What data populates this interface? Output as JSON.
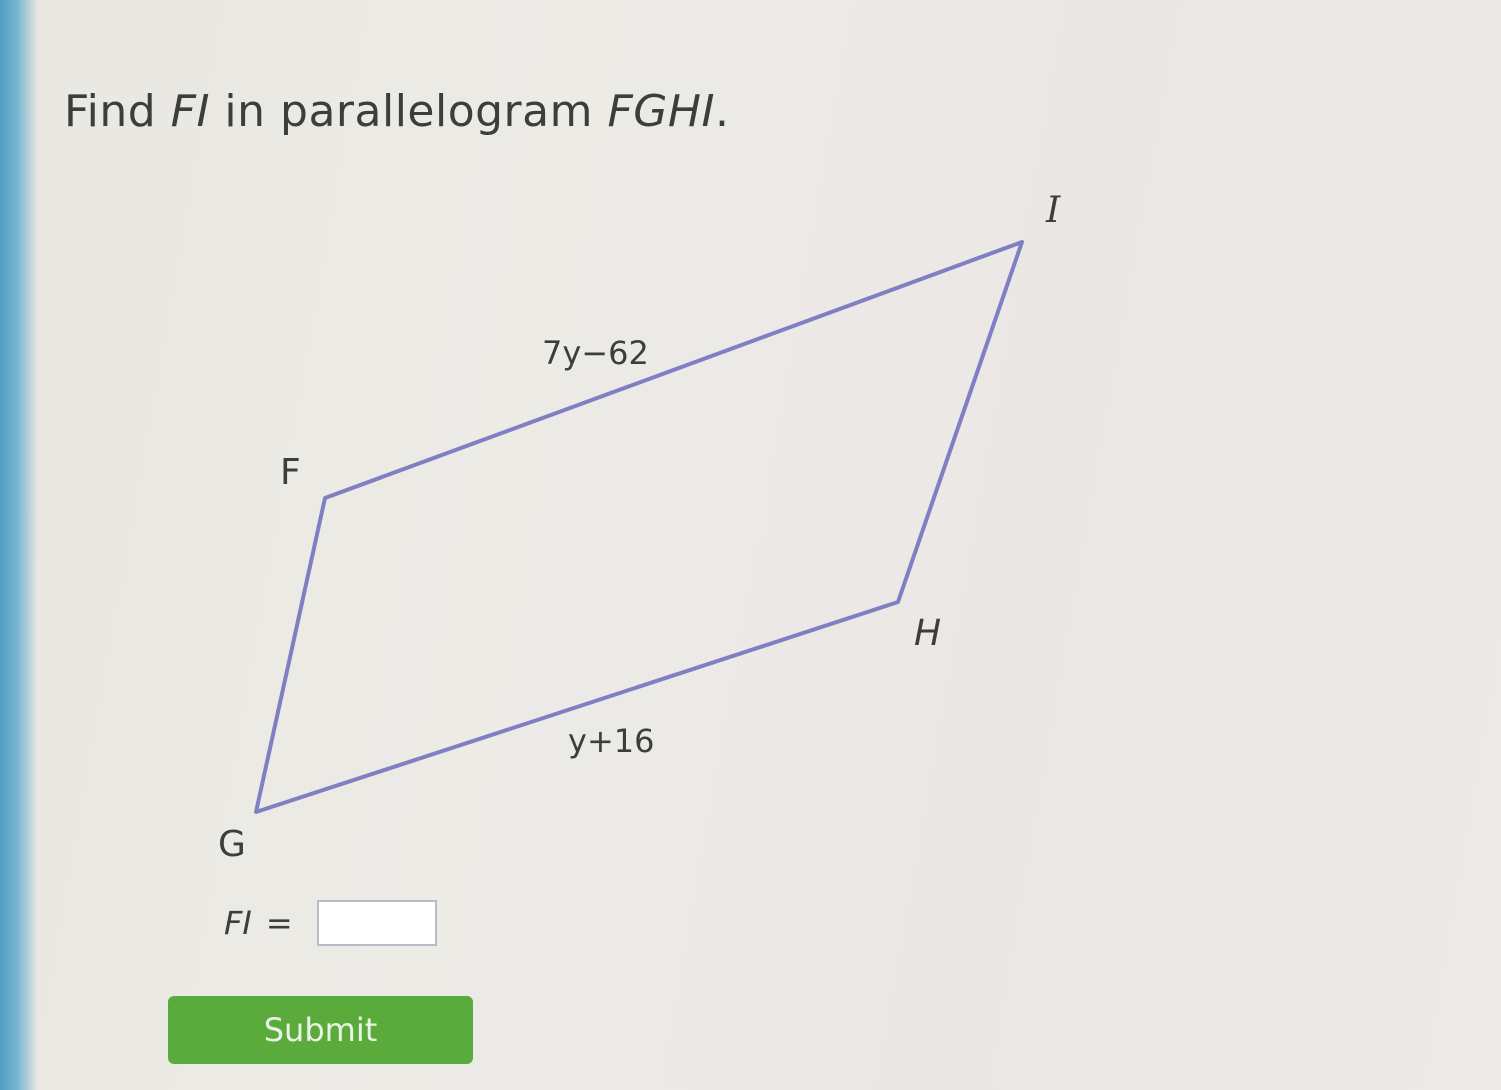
{
  "question": {
    "prefix": "Find ",
    "var1": "FI",
    "middle": " in parallelogram ",
    "var2": "FGHI",
    "suffix": "."
  },
  "diagram": {
    "vertices": {
      "F": "F",
      "G": "G",
      "H": "H",
      "I": "I"
    },
    "top_side_label": "7y−62",
    "bottom_side_label": "y+16",
    "stroke_color": "#7f7fc3"
  },
  "answer": {
    "label_var": "FI",
    "equals": "=",
    "value": ""
  },
  "submit_label": "Submit",
  "colors": {
    "submit_green": "#5aab3c",
    "left_panel_blue": "#5aa5c8"
  }
}
